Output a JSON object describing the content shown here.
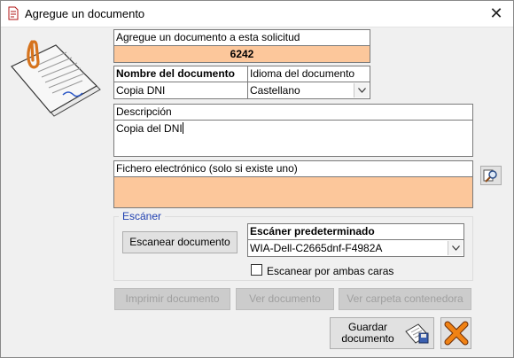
{
  "window": {
    "title": "Agregue un documento",
    "close_symbol": "✕"
  },
  "request": {
    "header": "Agregue un documento a esta solicitud",
    "number": "6242"
  },
  "doc_name": {
    "label": "Nombre del documento",
    "value": "Copia DNI"
  },
  "language": {
    "label": "Idioma del documento",
    "value": "Castellano"
  },
  "description": {
    "label": "Descripción",
    "value": "Copia del DNI"
  },
  "file": {
    "label": "Fichero electrónico (solo si existe uno)",
    "value": ""
  },
  "scanner": {
    "group_title": "Escáner",
    "scan_button": "Escanear documento",
    "default_label": "Escáner predeterminado",
    "default_value": "WIA-Dell-C2665dnf-F4982A",
    "both_sides_label": "Escanear por ambas caras",
    "both_sides_checked": false
  },
  "actions": {
    "print": "Imprimir documento",
    "view": "Ver documento",
    "view_folder": "Ver carpeta contenedora",
    "save_line1": "Guardar",
    "save_line2": "documento"
  },
  "icons": {
    "app": "document-add-icon",
    "illustration": "document-with-paperclip-icon",
    "browse": "magnifier-browse-icon",
    "save": "save-document-icon",
    "cancel": "cancel-x-icon"
  },
  "colors": {
    "required_field": "#fcc79b",
    "group_title": "#1f3fb0"
  }
}
